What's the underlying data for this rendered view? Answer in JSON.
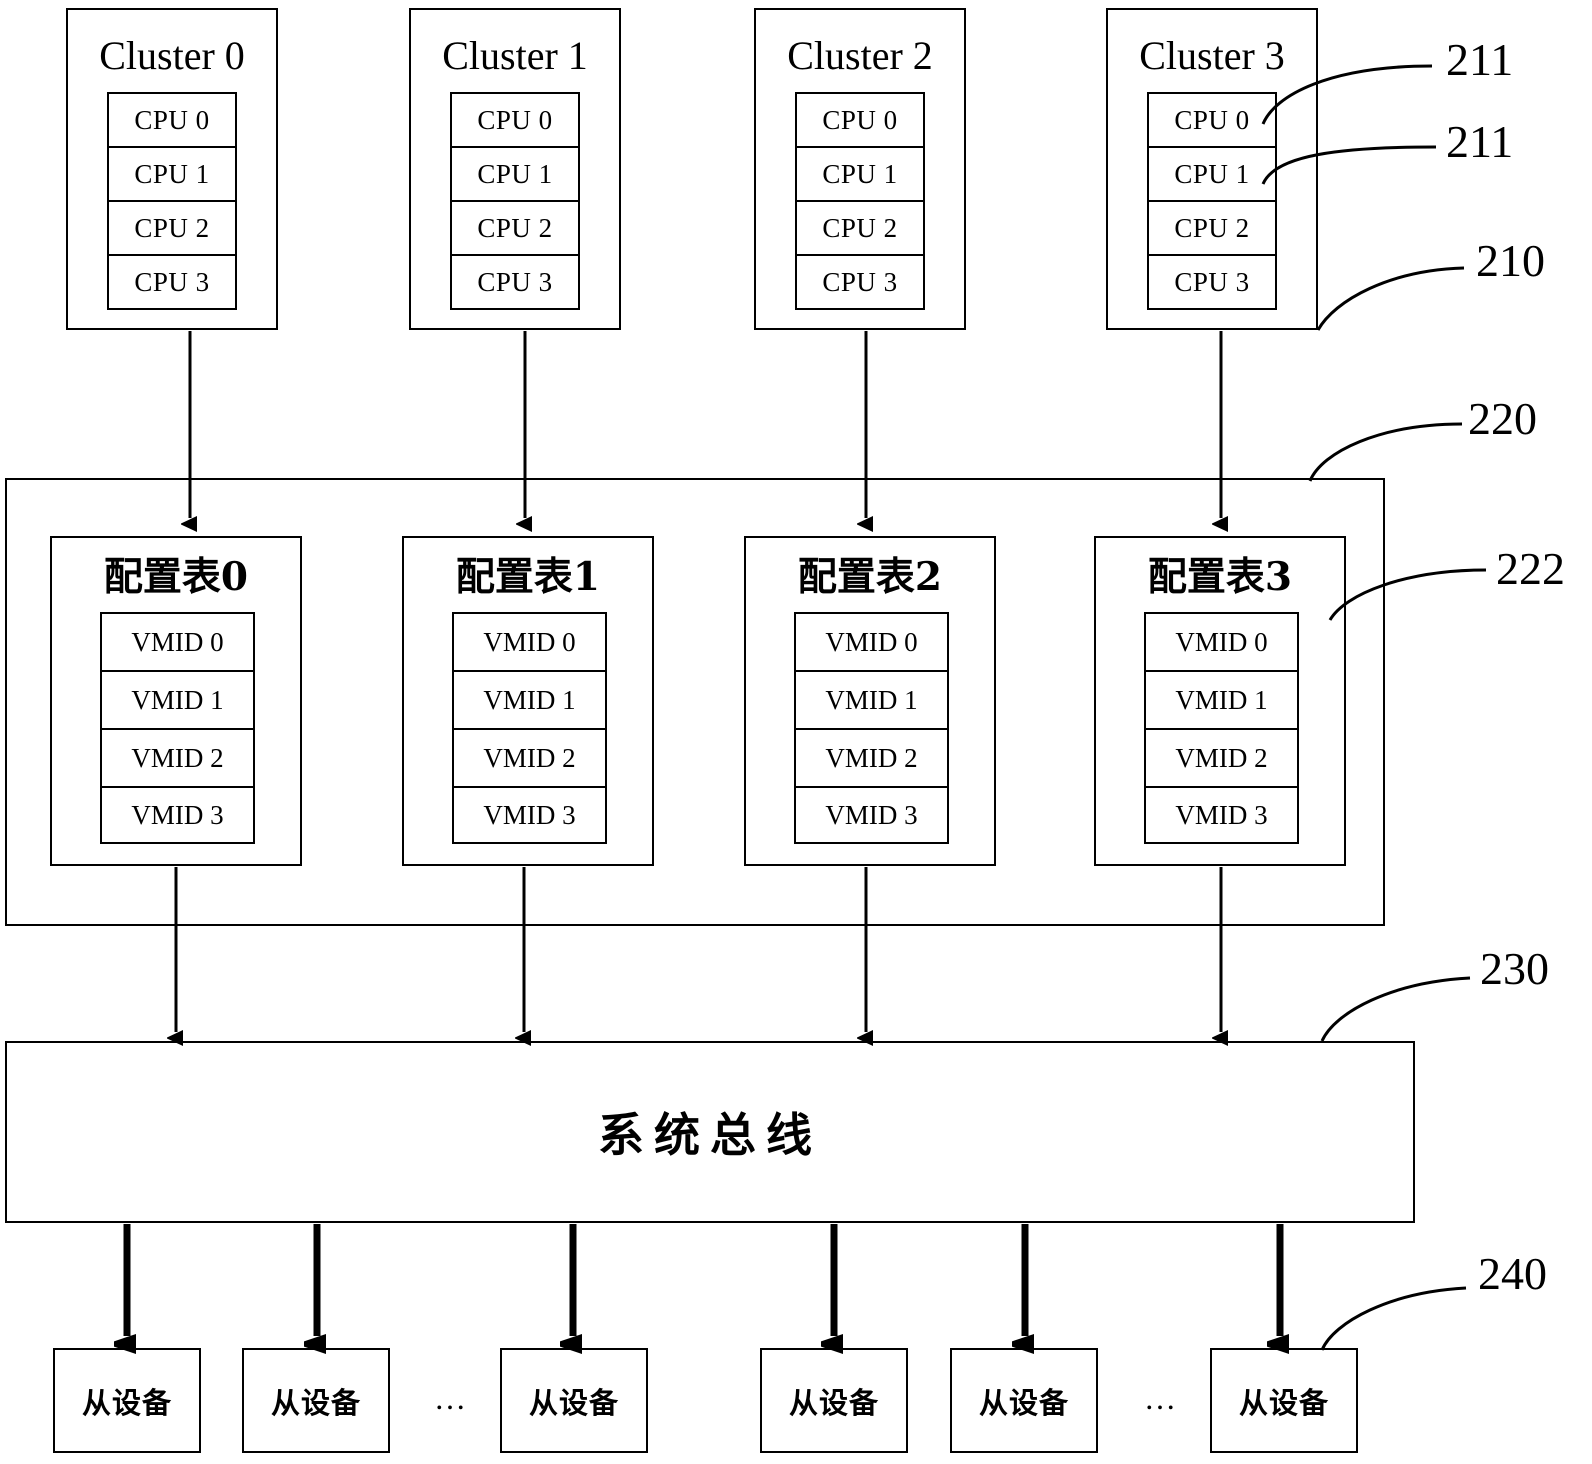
{
  "figure": {
    "title": "System-on-chip cluster / configuration table / system bus architecture diagram",
    "language": "zh-CN"
  },
  "clusters": [
    {
      "label": "Cluster 0",
      "cpus": [
        "CPU 0",
        "CPU 1",
        "CPU 2",
        "CPU 3"
      ]
    },
    {
      "label": "Cluster 1",
      "cpus": [
        "CPU 0",
        "CPU 1",
        "CPU 2",
        "CPU 3"
      ]
    },
    {
      "label": "Cluster 2",
      "cpus": [
        "CPU 0",
        "CPU 1",
        "CPU 2",
        "CPU 3"
      ]
    },
    {
      "label": "Cluster 3",
      "cpus": [
        "CPU 0",
        "CPU 1",
        "CPU 2",
        "CPU 3"
      ]
    }
  ],
  "config_tables": [
    {
      "label": "配置表0",
      "vmids": [
        "VMID 0",
        "VMID 1",
        "VMID 2",
        "VMID 3"
      ]
    },
    {
      "label": "配置表1",
      "vmids": [
        "VMID 0",
        "VMID 1",
        "VMID 2",
        "VMID 3"
      ]
    },
    {
      "label": "配置表2",
      "vmids": [
        "VMID 0",
        "VMID 1",
        "VMID 2",
        "VMID 3"
      ]
    },
    {
      "label": "配置表3",
      "vmids": [
        "VMID 0",
        "VMID 1",
        "VMID 2",
        "VMID 3"
      ]
    }
  ],
  "bus": {
    "label": "系统总线"
  },
  "slaves": [
    {
      "label": "从设备"
    },
    {
      "label": "从设备"
    },
    {
      "label": "从设备"
    },
    {
      "label": "从设备"
    },
    {
      "label": "从设备"
    },
    {
      "label": "从设备"
    }
  ],
  "ellipses": [
    {
      "text": "…"
    },
    {
      "text": "…"
    }
  ],
  "reference_numerals": [
    {
      "text": "211"
    },
    {
      "text": "211"
    },
    {
      "text": "210"
    },
    {
      "text": "220"
    },
    {
      "text": "222"
    },
    {
      "text": "230"
    },
    {
      "text": "240"
    }
  ],
  "colors": {
    "line": "#000000",
    "background": "#ffffff",
    "text": "#000000"
  }
}
